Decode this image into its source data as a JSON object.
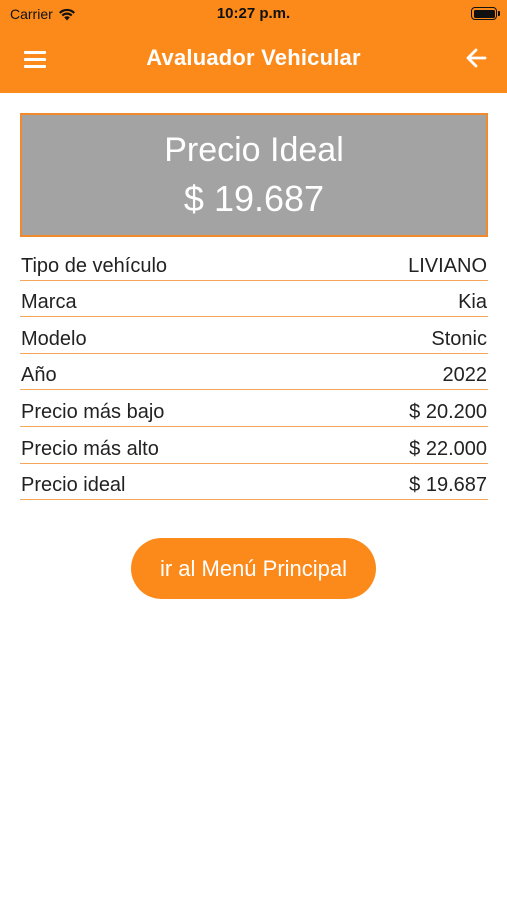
{
  "status_bar": {
    "carrier": "Carrier",
    "time": "10:27 p.m.",
    "wifi_icon": "wifi-icon",
    "battery_icon": "battery-icon"
  },
  "app_bar": {
    "title": "Avaluador Vehicular",
    "menu_icon": "hamburger-menu-icon",
    "back_icon": "arrow-left-icon",
    "background_color": "#fb8a1b"
  },
  "price_card": {
    "label": "Precio Ideal",
    "value": "$ 19.687",
    "background_color": "#a3a3a3",
    "border_color": "#f08a2c"
  },
  "details": [
    {
      "label": "Tipo de vehículo",
      "value": "LIVIANO"
    },
    {
      "label": "Marca",
      "value": "Kia"
    },
    {
      "label": "Modelo",
      "value": "Stonic"
    },
    {
      "label": "Año",
      "value": "2022"
    },
    {
      "label": "Precio más bajo",
      "value": "$ 20.200"
    },
    {
      "label": "Precio más alto",
      "value": "$ 22.000"
    },
    {
      "label": "Precio ideal",
      "value": "$ 19.687"
    }
  ],
  "main_menu_button": {
    "label": "ir al Menú Principal",
    "color": "#fb8a1b"
  }
}
